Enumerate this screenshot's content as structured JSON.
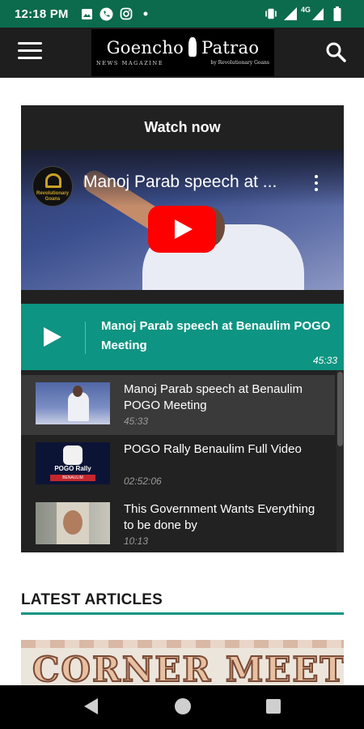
{
  "status_bar": {
    "time": "12:18 PM",
    "icons_left": [
      "image-icon",
      "phone-icon",
      "instagram-icon",
      "dot-icon"
    ],
    "network": "4G",
    "icons_right": [
      "vibrate-icon",
      "signal-icon",
      "battery-icon"
    ]
  },
  "app_bar": {
    "logo_title_left": "Goencho",
    "logo_title_right": "Patrao",
    "logo_subtitle": "NEWS MAGAZINE",
    "logo_byline": "by Revolutionary Goans"
  },
  "watch": {
    "header": "Watch now",
    "video_title": "Manoj Parab speech at ...",
    "channel_name": "Revolutionary Goans"
  },
  "now_playing": {
    "title": "Manoj Parab speech at Benaulim POGO Meeting",
    "duration": "45:33"
  },
  "playlist": [
    {
      "title": "Manoj Parab speech at Benaulim POGO Meeting",
      "duration": "45:33",
      "active": true
    },
    {
      "title": "POGO Rally Benaulim Full Video",
      "duration": "02:52:06",
      "active": false,
      "thumb_text": "POGO Rally",
      "thumb_caption": "BENAULIM"
    },
    {
      "title": "This Government Wants Everything to be done by",
      "duration": "10:13",
      "active": false
    }
  ],
  "latest": {
    "heading": "LATEST ARTICLES",
    "article_image_text": "CORNER MEET"
  },
  "colors": {
    "status_bar": "#0b6b4c",
    "app_bar": "#1e1e1e",
    "accent": "#0e9482",
    "youtube_red": "#ff0000"
  }
}
